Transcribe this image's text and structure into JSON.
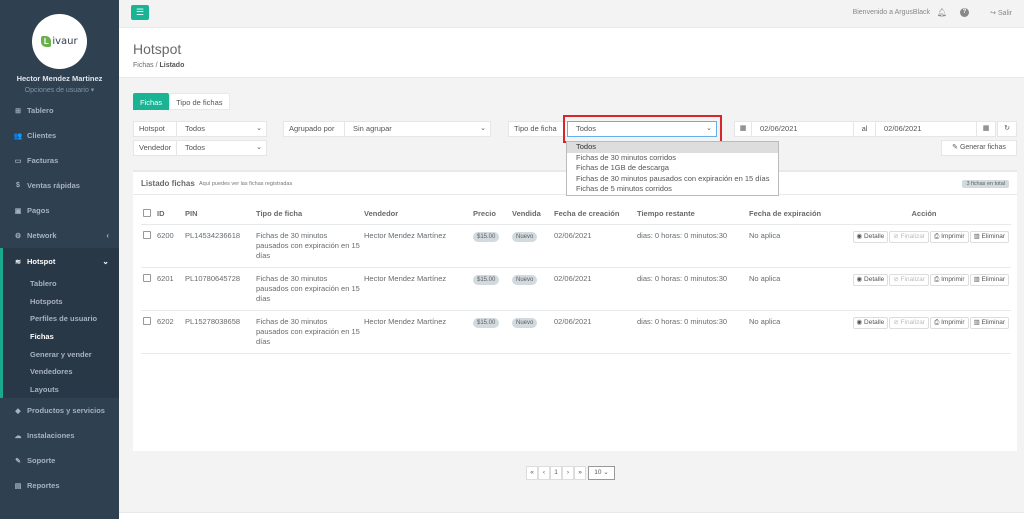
{
  "topbar": {
    "menu_icon": "bars-icon",
    "welcome": "Bienvenido a ArgusBlack",
    "logout": "Salir"
  },
  "profile": {
    "logo_text": "ivaur",
    "logo_mark": "L",
    "name": "Hector Mendez Martinez",
    "options": "Opciones de usuario ▾"
  },
  "nav": [
    {
      "icon": "tachometer-icon",
      "glyph": "⊞",
      "label": "Tablero"
    },
    {
      "icon": "users-icon",
      "glyph": "👥",
      "label": "Clientes"
    },
    {
      "icon": "file-icon",
      "glyph": "▭",
      "label": "Facturas"
    },
    {
      "icon": "dollar-icon",
      "glyph": "$",
      "label": "Ventas rápidas"
    },
    {
      "icon": "money-icon",
      "glyph": "▣",
      "label": "Pagos"
    },
    {
      "icon": "sitemap-icon",
      "glyph": "⚙",
      "label": "Network"
    }
  ],
  "hotspot": {
    "label": "Hotspot",
    "sub": [
      "Tablero",
      "Hotspots",
      "Perfiles de usuario",
      "Fichas",
      "Generar y vender",
      "Vendedores",
      "Layouts"
    ],
    "active_index": 3
  },
  "nav_bottom": [
    {
      "icon": "tags-icon",
      "glyph": "◆",
      "label": "Productos y servicios"
    },
    {
      "icon": "cloud-icon",
      "glyph": "☁",
      "label": "Instalaciones"
    },
    {
      "icon": "wrench-icon",
      "glyph": "✎",
      "label": "Soporte"
    },
    {
      "icon": "chart-icon",
      "glyph": "▤",
      "label": "Reportes"
    }
  ],
  "page": {
    "title": "Hotspot",
    "breadcrumb_parent": "Fichas",
    "breadcrumb_current": "Listado"
  },
  "tabs": [
    "Fichas",
    "Tipo de fichas"
  ],
  "filters": {
    "hotspot_label": "Hotspot",
    "hotspot_value": "Todos",
    "group_label": "Agrupado por",
    "group_value": "Sin agrupar",
    "tipo_label": "Tipo de ficha",
    "tipo_value": "Todos",
    "date_from": "02/06/2021",
    "date_sep": "al",
    "date_to": "02/06/2021",
    "vendedor_label": "Vendedor",
    "vendedor_value": "Todos",
    "generate_button": "Generar fichas"
  },
  "dropdown": {
    "options": [
      "Todos",
      "Fichas de 30 minutos corridos",
      "Fichas de 1GB de descarga",
      "Fichas de 30 minutos pausados con expiración en 15 días",
      "Fichas de 5 minutos corridos"
    ],
    "selected_index": 0
  },
  "panel": {
    "title": "Listado fichas",
    "subtitle": "Aquí puedes ver las fichas registradas",
    "total": "3 fichas en total"
  },
  "table": {
    "headers": [
      "ID",
      "PIN",
      "Tipo de ficha",
      "Vendedor",
      "Precio",
      "Vendida",
      "Fecha de creación",
      "Tiempo restante",
      "Fecha de expiración",
      "Acción"
    ],
    "rows": [
      {
        "id": "6200",
        "pin": "PL14534236618",
        "tipo": "Fichas de 30 minutos pausados con expiración en 15 días",
        "vendedor": "Hector Mendez Martínez",
        "precio": "$15.00",
        "vendida": "Nuevo",
        "creacion": "02/06/2021",
        "restante": "dias: 0 horas: 0 minutos:30",
        "expiracion": "No aplica"
      },
      {
        "id": "6201",
        "pin": "PL10780645728",
        "tipo": "Fichas de 30 minutos pausados con expiración en 15 días",
        "vendedor": "Hector Mendez Martínez",
        "precio": "$15.00",
        "vendida": "Nuevo",
        "creacion": "02/06/2021",
        "restante": "dias: 0 horas: 0 minutos:30",
        "expiracion": "No aplica"
      },
      {
        "id": "6202",
        "pin": "PL15278038658",
        "tipo": "Fichas de 30 minutos pausados con expiración en 15 días",
        "vendedor": "Hector Mendez Martínez",
        "precio": "$15.00",
        "vendida": "Nuevo",
        "creacion": "02/06/2021",
        "restante": "dias: 0 horas: 0 minutos:30",
        "expiracion": "No aplica"
      }
    ],
    "actions": [
      "Detalle",
      "Finalizar",
      "Imprimir",
      "Eliminar"
    ]
  },
  "pagination": {
    "first": "«",
    "prev": "‹",
    "page": "1",
    "next": "›",
    "last": "»",
    "page_size": "10"
  }
}
